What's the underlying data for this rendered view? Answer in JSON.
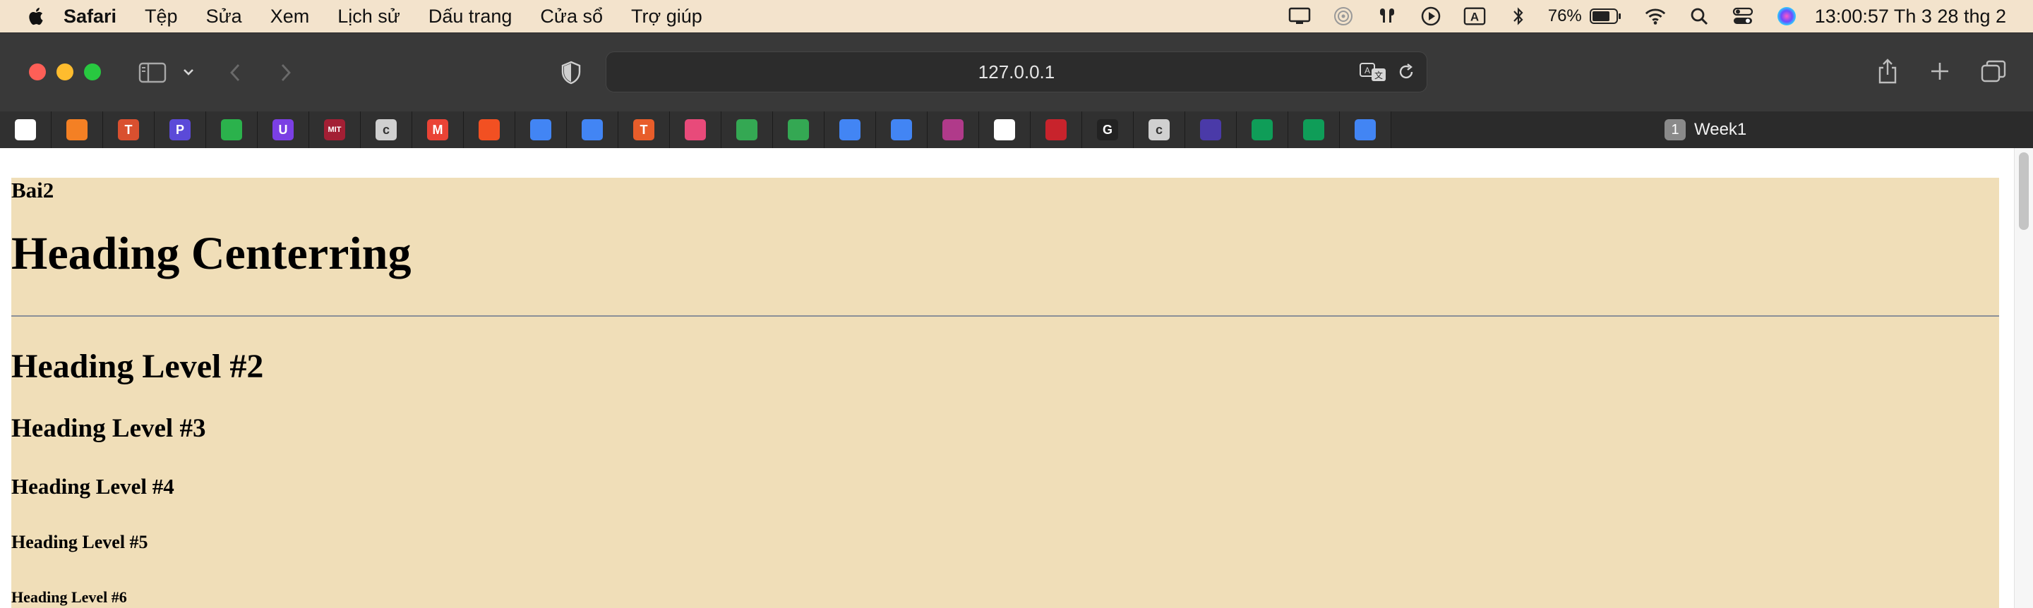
{
  "menubar": {
    "app_name": "Safari",
    "items": [
      "Tệp",
      "Sửa",
      "Xem",
      "Lịch sử",
      "Dấu trang",
      "Cửa sổ",
      "Trợ giúp"
    ],
    "battery_percent": "76%",
    "clock": "13:00:57 Th 3 28 thg 2",
    "status_icons": [
      "display-icon",
      "airdrop-icon",
      "airpods-icon",
      "play-icon",
      "input-source-icon",
      "bluetooth-icon",
      "battery-icon",
      "wifi-icon",
      "spotlight-icon",
      "control-center-icon",
      "siri-icon"
    ]
  },
  "toolbar": {
    "url": "127.0.0.1"
  },
  "favorites": [
    {
      "name": "fav-1",
      "glyph": "",
      "color": "#ffffff"
    },
    {
      "name": "fav-stackoverflow",
      "glyph": "",
      "color": "#f48024"
    },
    {
      "name": "fav-t-red",
      "glyph": "T",
      "color": "#d9502f"
    },
    {
      "name": "fav-p",
      "glyph": "P",
      "color": "#5b4ad8"
    },
    {
      "name": "fav-feedly",
      "glyph": "",
      "color": "#2bb24c"
    },
    {
      "name": "fav-u",
      "glyph": "U",
      "color": "#7b3fe4"
    },
    {
      "name": "fav-mit",
      "glyph": "MIT",
      "color": "#a31f34"
    },
    {
      "name": "fav-c",
      "glyph": "c",
      "color": "#d0d0d0"
    },
    {
      "name": "fav-gmail",
      "glyph": "M",
      "color": "#ea4335"
    },
    {
      "name": "fav-microsoft",
      "glyph": "",
      "color": "#f25022"
    },
    {
      "name": "fav-docs-1",
      "glyph": "",
      "color": "#4285f4"
    },
    {
      "name": "fav-docs-2",
      "glyph": "",
      "color": "#4285f4"
    },
    {
      "name": "fav-t-orange",
      "glyph": "T",
      "color": "#e85d2a"
    },
    {
      "name": "fav-sketch",
      "glyph": "",
      "color": "#e84a7a"
    },
    {
      "name": "fav-drive-1",
      "glyph": "",
      "color": "#34a853"
    },
    {
      "name": "fav-drive-2",
      "glyph": "",
      "color": "#34a853"
    },
    {
      "name": "fav-docs-3",
      "glyph": "",
      "color": "#4285f4"
    },
    {
      "name": "fav-docs-4",
      "glyph": "",
      "color": "#4285f4"
    },
    {
      "name": "fav-dots",
      "glyph": "",
      "color": "#b03a8a"
    },
    {
      "name": "fav-bird",
      "glyph": "",
      "color": "#ffffff"
    },
    {
      "name": "fav-waves",
      "glyph": "",
      "color": "#c8232c"
    },
    {
      "name": "fav-g",
      "glyph": "G",
      "color": "#222222"
    },
    {
      "name": "fav-c2",
      "glyph": "c",
      "color": "#d0d0d0"
    },
    {
      "name": "fav-circle",
      "glyph": "",
      "color": "#4a3aa8"
    },
    {
      "name": "fav-sheets-1",
      "glyph": "",
      "color": "#0f9d58"
    },
    {
      "name": "fav-sheets-2",
      "glyph": "",
      "color": "#0f9d58"
    },
    {
      "name": "fav-docs-5",
      "glyph": "",
      "color": "#4285f4"
    }
  ],
  "tab_group": {
    "count": "1",
    "name": "Week1"
  },
  "page": {
    "h_bai": "Bai2",
    "h1": "Heading Centerring",
    "h2": "Heading Level #2",
    "h3": "Heading Level #3",
    "h4": "Heading Level #4",
    "h5": "Heading Level #5",
    "h6": "Heading Level #6",
    "background_color": "#f0deb8"
  }
}
